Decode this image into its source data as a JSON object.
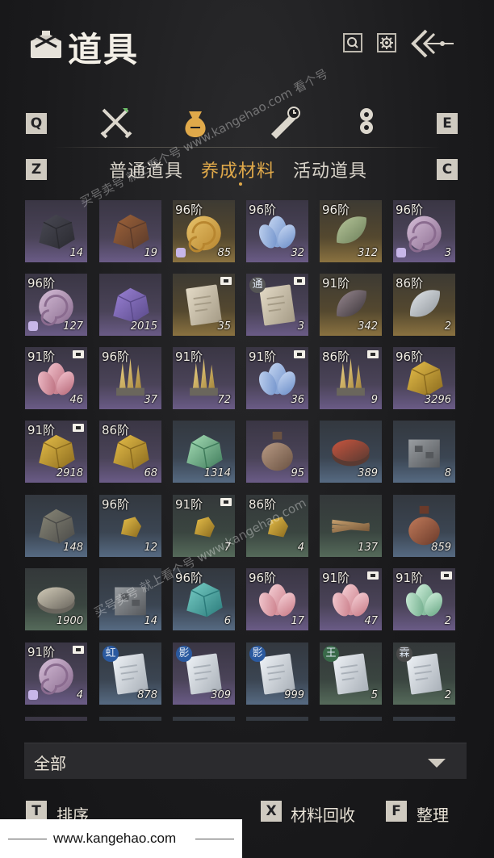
{
  "header": {
    "title": "道具"
  },
  "category_tabs": {
    "left_key": "Q",
    "right_key": "E",
    "icons": [
      "crossed-swords-icon",
      "pouch-icon",
      "scroll-clock-icon",
      "coins-icon"
    ],
    "active_index": 1
  },
  "sub_tabs": {
    "left_key": "Z",
    "right_key": "C",
    "items": [
      "普通道具",
      "养成材料",
      "活动道具"
    ],
    "active_index": 1
  },
  "items": [
    {
      "icon": "black-ore-icon",
      "tier": "",
      "count": "14",
      "rarity": "purple"
    },
    {
      "icon": "copper-ore-icon",
      "tier": "",
      "count": "19",
      "rarity": "purple"
    },
    {
      "icon": "golden-snail-shell-icon",
      "tier": "96阶",
      "count": "85",
      "rarity": "gold",
      "bound": true
    },
    {
      "icon": "blue-spirit-flower-icon",
      "tier": "96阶",
      "count": "32",
      "rarity": "purple"
    },
    {
      "icon": "green-scale-icon",
      "tier": "96阶",
      "count": "312",
      "rarity": "gold"
    },
    {
      "icon": "purple-snail-shell-icon",
      "tier": "96阶",
      "count": "3",
      "rarity": "purple",
      "bound": true
    },
    {
      "icon": "purple-snail-shell-icon",
      "tier": "96阶",
      "count": "127",
      "rarity": "purple",
      "bound": true
    },
    {
      "icon": "purple-plant-icon",
      "tier": "",
      "count": "2015",
      "rarity": "purple"
    },
    {
      "icon": "manual-book-icon",
      "tier": "",
      "count": "35",
      "rarity": "gold",
      "locked": true
    },
    {
      "icon": "manual-book-icon",
      "tier": "",
      "count": "3",
      "rarity": "purple",
      "locked": true,
      "seal": "通"
    },
    {
      "icon": "dark-scale-icon",
      "tier": "91阶",
      "count": "342",
      "rarity": "gold"
    },
    {
      "icon": "white-scale-icon",
      "tier": "86阶",
      "count": "2",
      "rarity": "gold"
    },
    {
      "icon": "pink-flower-icon",
      "tier": "91阶",
      "count": "46",
      "rarity": "purple",
      "locked": true
    },
    {
      "icon": "golden-crystal-cluster-icon",
      "tier": "96阶",
      "count": "37",
      "rarity": "purple"
    },
    {
      "icon": "golden-crystal-cluster-icon",
      "tier": "91阶",
      "count": "72",
      "rarity": "purple"
    },
    {
      "icon": "blue-spirit-flower-icon",
      "tier": "91阶",
      "count": "36",
      "rarity": "purple",
      "locked": true
    },
    {
      "icon": "golden-crystal-cluster-icon",
      "tier": "86阶",
      "count": "9",
      "rarity": "purple",
      "locked": true
    },
    {
      "icon": "gold-nugget-icon",
      "tier": "96阶",
      "count": "3296",
      "rarity": "purple"
    },
    {
      "icon": "gold-nugget-icon",
      "tier": "91阶",
      "count": "2918",
      "rarity": "purple",
      "locked": true
    },
    {
      "icon": "gold-nugget-icon",
      "tier": "86阶",
      "count": "68",
      "rarity": "purple"
    },
    {
      "icon": "jade-stone-icon",
      "tier": "",
      "count": "1314",
      "rarity": "blue"
    },
    {
      "icon": "gourd-flask-icon",
      "tier": "",
      "count": "95",
      "rarity": "purple"
    },
    {
      "icon": "cinnabar-box-icon",
      "tier": "",
      "count": "389",
      "rarity": "blue"
    },
    {
      "icon": "stone-block-icon",
      "tier": "",
      "count": "8",
      "rarity": "blue"
    },
    {
      "icon": "grey-ore-icon",
      "tier": "",
      "count": "148",
      "rarity": "blue"
    },
    {
      "icon": "small-gold-nugget-icon",
      "tier": "96阶",
      "count": "12",
      "rarity": "blue"
    },
    {
      "icon": "small-gold-nugget-icon",
      "tier": "91阶",
      "count": "7",
      "rarity": "green",
      "locked": true
    },
    {
      "icon": "small-gold-nugget-icon",
      "tier": "86阶",
      "count": "4",
      "rarity": "green"
    },
    {
      "icon": "wood-bundle-icon",
      "tier": "",
      "count": "137",
      "rarity": "green"
    },
    {
      "icon": "clay-jar-icon",
      "tier": "",
      "count": "859",
      "rarity": "blue"
    },
    {
      "icon": "ointment-tin-icon",
      "tier": "",
      "count": "1900",
      "rarity": "green"
    },
    {
      "icon": "stone-block-icon",
      "tier": "",
      "count": "14",
      "rarity": "blue"
    },
    {
      "icon": "turquoise-ore-icon",
      "tier": "96阶",
      "count": "6",
      "rarity": "blue"
    },
    {
      "icon": "pink-lotus-icon",
      "tier": "96阶",
      "count": "17",
      "rarity": "purple"
    },
    {
      "icon": "pink-lotus-icon",
      "tier": "91阶",
      "count": "47",
      "rarity": "purple",
      "locked": true
    },
    {
      "icon": "green-lotus-icon",
      "tier": "91阶",
      "count": "2",
      "rarity": "purple",
      "locked": true
    },
    {
      "icon": "purple-snail-shell-icon",
      "tier": "91阶",
      "count": "4",
      "rarity": "purple",
      "locked": true,
      "bound": true
    },
    {
      "icon": "letter-envelope-icon",
      "tier": "",
      "count": "878",
      "rarity": "blue",
      "seal": "虹"
    },
    {
      "icon": "letter-envelope-icon",
      "tier": "",
      "count": "309",
      "rarity": "purple",
      "seal": "影"
    },
    {
      "icon": "letter-envelope-icon",
      "tier": "",
      "count": "999",
      "rarity": "blue",
      "seal": "影"
    },
    {
      "icon": "letter-envelope-icon",
      "tier": "",
      "count": "5",
      "rarity": "green",
      "seal": "王"
    },
    {
      "icon": "letter-envelope-icon",
      "tier": "",
      "count": "2",
      "rarity": "green",
      "seal": "霖"
    }
  ],
  "filter": {
    "label": "全部"
  },
  "bottom_bar": {
    "sort_key": "T",
    "sort_label": "排序",
    "recycle_key": "X",
    "recycle_label": "材料回收",
    "arrange_key": "F",
    "arrange_label": "整理"
  },
  "watermark": {
    "lines": [
      "买号卖号",
      "就上看个号",
      "www.kangehao.com",
      "看个号"
    ]
  },
  "footer": {
    "url": "www.kangehao.com"
  },
  "colors": {
    "accent": "#e0a94a",
    "purple_rarity": "#6a5b86",
    "gold_rarity": "#8a7240",
    "blue_rarity": "#566a82",
    "green_rarity": "#556a5a"
  }
}
